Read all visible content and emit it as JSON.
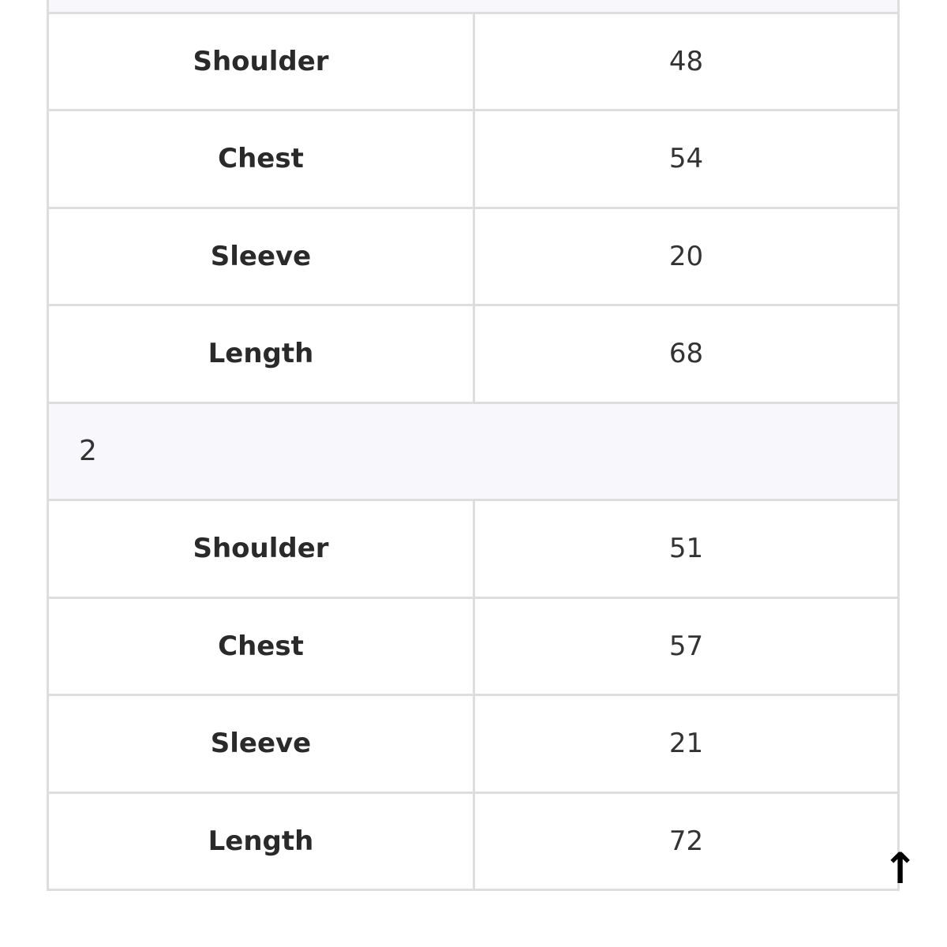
{
  "groups": [
    {
      "label": "",
      "rows": [
        {
          "label": "Shoulder",
          "value": "48"
        },
        {
          "label": "Chest",
          "value": "54"
        },
        {
          "label": "Sleeve",
          "value": "20"
        },
        {
          "label": "Length",
          "value": "68"
        }
      ]
    },
    {
      "label": "2",
      "rows": [
        {
          "label": "Shoulder",
          "value": "51"
        },
        {
          "label": "Chest",
          "value": "57"
        },
        {
          "label": "Sleeve",
          "value": "21"
        },
        {
          "label": "Length",
          "value": "72"
        }
      ]
    }
  ],
  "scroll_top_icon": "arrow-up-icon",
  "colors": {
    "group_bg": "#f8f8fc",
    "border": "#dddddd"
  }
}
